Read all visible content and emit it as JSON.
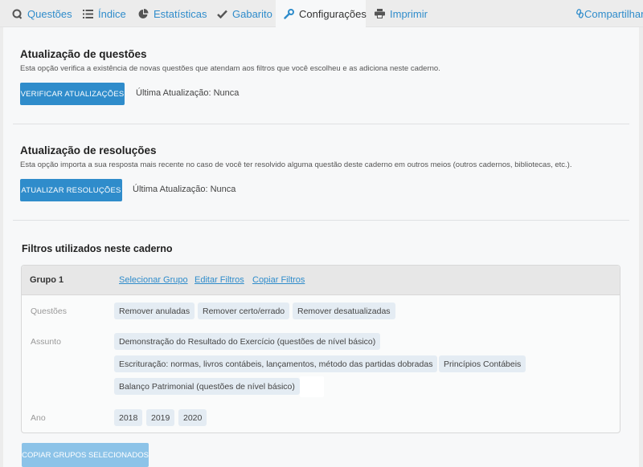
{
  "tabs": [
    {
      "label": "Questões",
      "icon": "q-icon"
    },
    {
      "label": "Índice",
      "icon": "list-icon"
    },
    {
      "label": "Estatísticas",
      "icon": "pie-chart-icon"
    },
    {
      "label": "Gabarito",
      "icon": "check-icon"
    },
    {
      "label": "Configurações",
      "icon": "wrench-icon"
    },
    {
      "label": "Imprimir",
      "icon": "printer-icon"
    }
  ],
  "share": {
    "label": "Compartilhar",
    "icon": "link-icon"
  },
  "active_tab": "Configurações",
  "updates": {
    "title": "Atualização de questões",
    "description": "Esta opção verifica a existência de novas questões que atendam aos filtros que você escolheu e as adiciona neste caderno.",
    "button": "VERIFICAR ATUALIZAÇÕES",
    "last_update": "Última Atualização: Nunca"
  },
  "resolutions": {
    "title": "Atualização de resoluções",
    "description": "Esta opção importa a sua resposta mais recente no caso de você ter resolvido alguma questão deste caderno em outros meios (outros cadernos, bibliotecas, etc.).",
    "button": "ATUALIZAR RESOLUÇÕES",
    "last_update": "Última Atualização: Nunca"
  },
  "filters": {
    "title": "Filtros utilizados neste caderno",
    "group": {
      "name": "Grupo 1",
      "links": [
        "Selecionar Grupo",
        "Editar Filtros",
        "Copiar Filtros"
      ],
      "rows": [
        {
          "label": "Questões",
          "chips": [
            "Remover anuladas",
            "Remover certo/errado",
            "Remover desatualizadas"
          ]
        },
        {
          "label": "Assunto",
          "chips": [
            "Demonstração do Resultado do Exercício (questões de nível básico)",
            "Escrituração: normas, livros contábeis, lançamentos, método das partidas dobradas",
            "Princípios Contábeis",
            "Balanço Patrimonial (questões de nível básico)"
          ]
        },
        {
          "label": "Ano",
          "chips": [
            "2018",
            "2019",
            "2020"
          ]
        }
      ]
    },
    "copy_button": "COPIAR GRUPOS SELECIONADOS"
  },
  "colors": {
    "accent": "#2f8ccb",
    "chip_bg": "#e4ecf3",
    "disabled": "#8cc3e8"
  }
}
